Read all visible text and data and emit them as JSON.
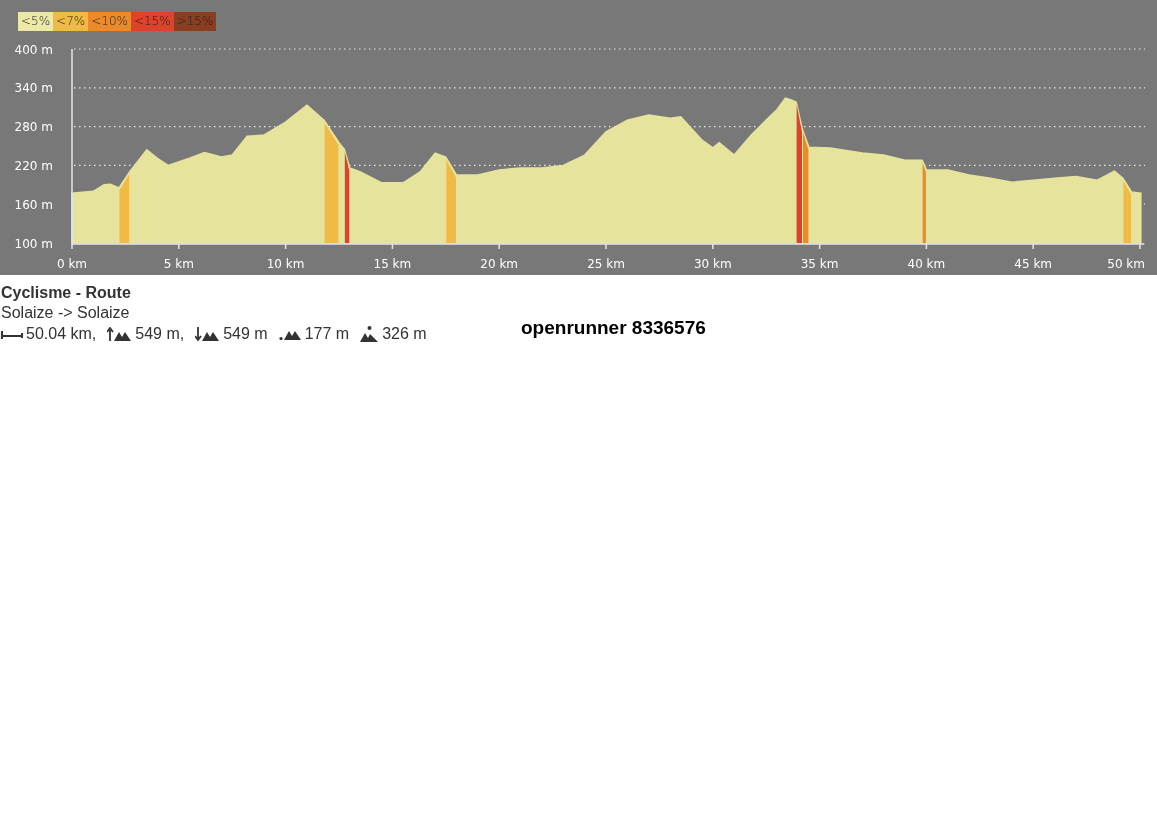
{
  "legend": [
    {
      "label": "<5%",
      "color": "#ece8a6"
    },
    {
      "label": "<7%",
      "color": "#f0bb44"
    },
    {
      "label": "<10%",
      "color": "#ec8a2a"
    },
    {
      "label": "<15%",
      "color": "#e0412a"
    },
    {
      "label": ">15%",
      "color": "#8b3d20"
    }
  ],
  "profile": {
    "chart_data": {
      "type": "area",
      "x": [
        0,
        1,
        1.5,
        1.8,
        2.2,
        2.7,
        3.5,
        4,
        4.5,
        5.5,
        6.2,
        7,
        7.5,
        8.2,
        9,
        10,
        11,
        11.8,
        12.5,
        12.75,
        13,
        13.5,
        14.5,
        15.5,
        16.3,
        17,
        17.5,
        18,
        19,
        20,
        21,
        22,
        23,
        24,
        25,
        26,
        27,
        28,
        28.5,
        29.5,
        30,
        30.3,
        31,
        31.8,
        32.5,
        33,
        33.4,
        33.7,
        33.9,
        34.2,
        34.5,
        35.5,
        37,
        38,
        39,
        39.8,
        40,
        41,
        42,
        43,
        44,
        45,
        46,
        47,
        48,
        48.8,
        49.2,
        49.6,
        50.04
      ],
      "series": [
        {
          "color": "#e6e49c",
          "values": [
            177,
            180,
            190,
            191,
            185,
            210,
            244,
            231,
            220,
            231,
            240,
            233,
            236,
            265,
            267,
            287,
            313,
            290,
            255,
            245,
            216,
            210,
            193,
            193,
            210,
            239,
            233,
            205,
            205,
            213,
            216,
            216,
            220,
            236,
            272,
            290,
            298,
            293,
            295,
            259,
            247,
            255,
            236,
            267,
            290,
            306,
            324,
            321,
            318,
            275,
            248,
            247,
            239,
            236,
            228,
            228,
            213,
            213,
            205,
            200,
            194,
            197,
            200,
            203,
            197,
            211,
            200,
            179,
            177
          ]
        }
      ],
      "grid": true,
      "xlim": [
        0,
        50.2
      ],
      "ylim": [
        100,
        400
      ],
      "xticks": [
        {
          "value": 0,
          "label": "0 km"
        },
        {
          "value": 5,
          "label": "5 km"
        },
        {
          "value": 10,
          "label": "10 km"
        },
        {
          "value": 15,
          "label": "15 km"
        },
        {
          "value": 20,
          "label": "20 km"
        },
        {
          "value": 25,
          "label": "25 km"
        },
        {
          "value": 30,
          "label": "30 km"
        },
        {
          "value": 35,
          "label": "35 km"
        },
        {
          "value": 40,
          "label": "40 km"
        },
        {
          "value": 45,
          "label": "45 km"
        },
        {
          "value": 50,
          "label": "50 km"
        }
      ],
      "yticks": [
        {
          "value": 100,
          "label": "100 m"
        },
        {
          "value": 160,
          "label": "160 m"
        },
        {
          "value": 220,
          "label": "220 m"
        },
        {
          "value": 280,
          "label": "280 m"
        },
        {
          "value": 340,
          "label": "340 m"
        },
        {
          "value": 400,
          "label": "400 m"
        }
      ]
    }
  },
  "activity": "Cyclisme - Route",
  "route": "Solaize  -> Solaize",
  "stats": [
    {
      "kind": "distance",
      "value": "50.04 km,"
    },
    {
      "kind": "ascent",
      "value": "549 m,"
    },
    {
      "kind": "descent",
      "value": "549 m"
    },
    {
      "kind": "min",
      "value": "177 m"
    },
    {
      "kind": "max",
      "value": "326 m"
    }
  ],
  "route_id": "openrunner 8336576"
}
